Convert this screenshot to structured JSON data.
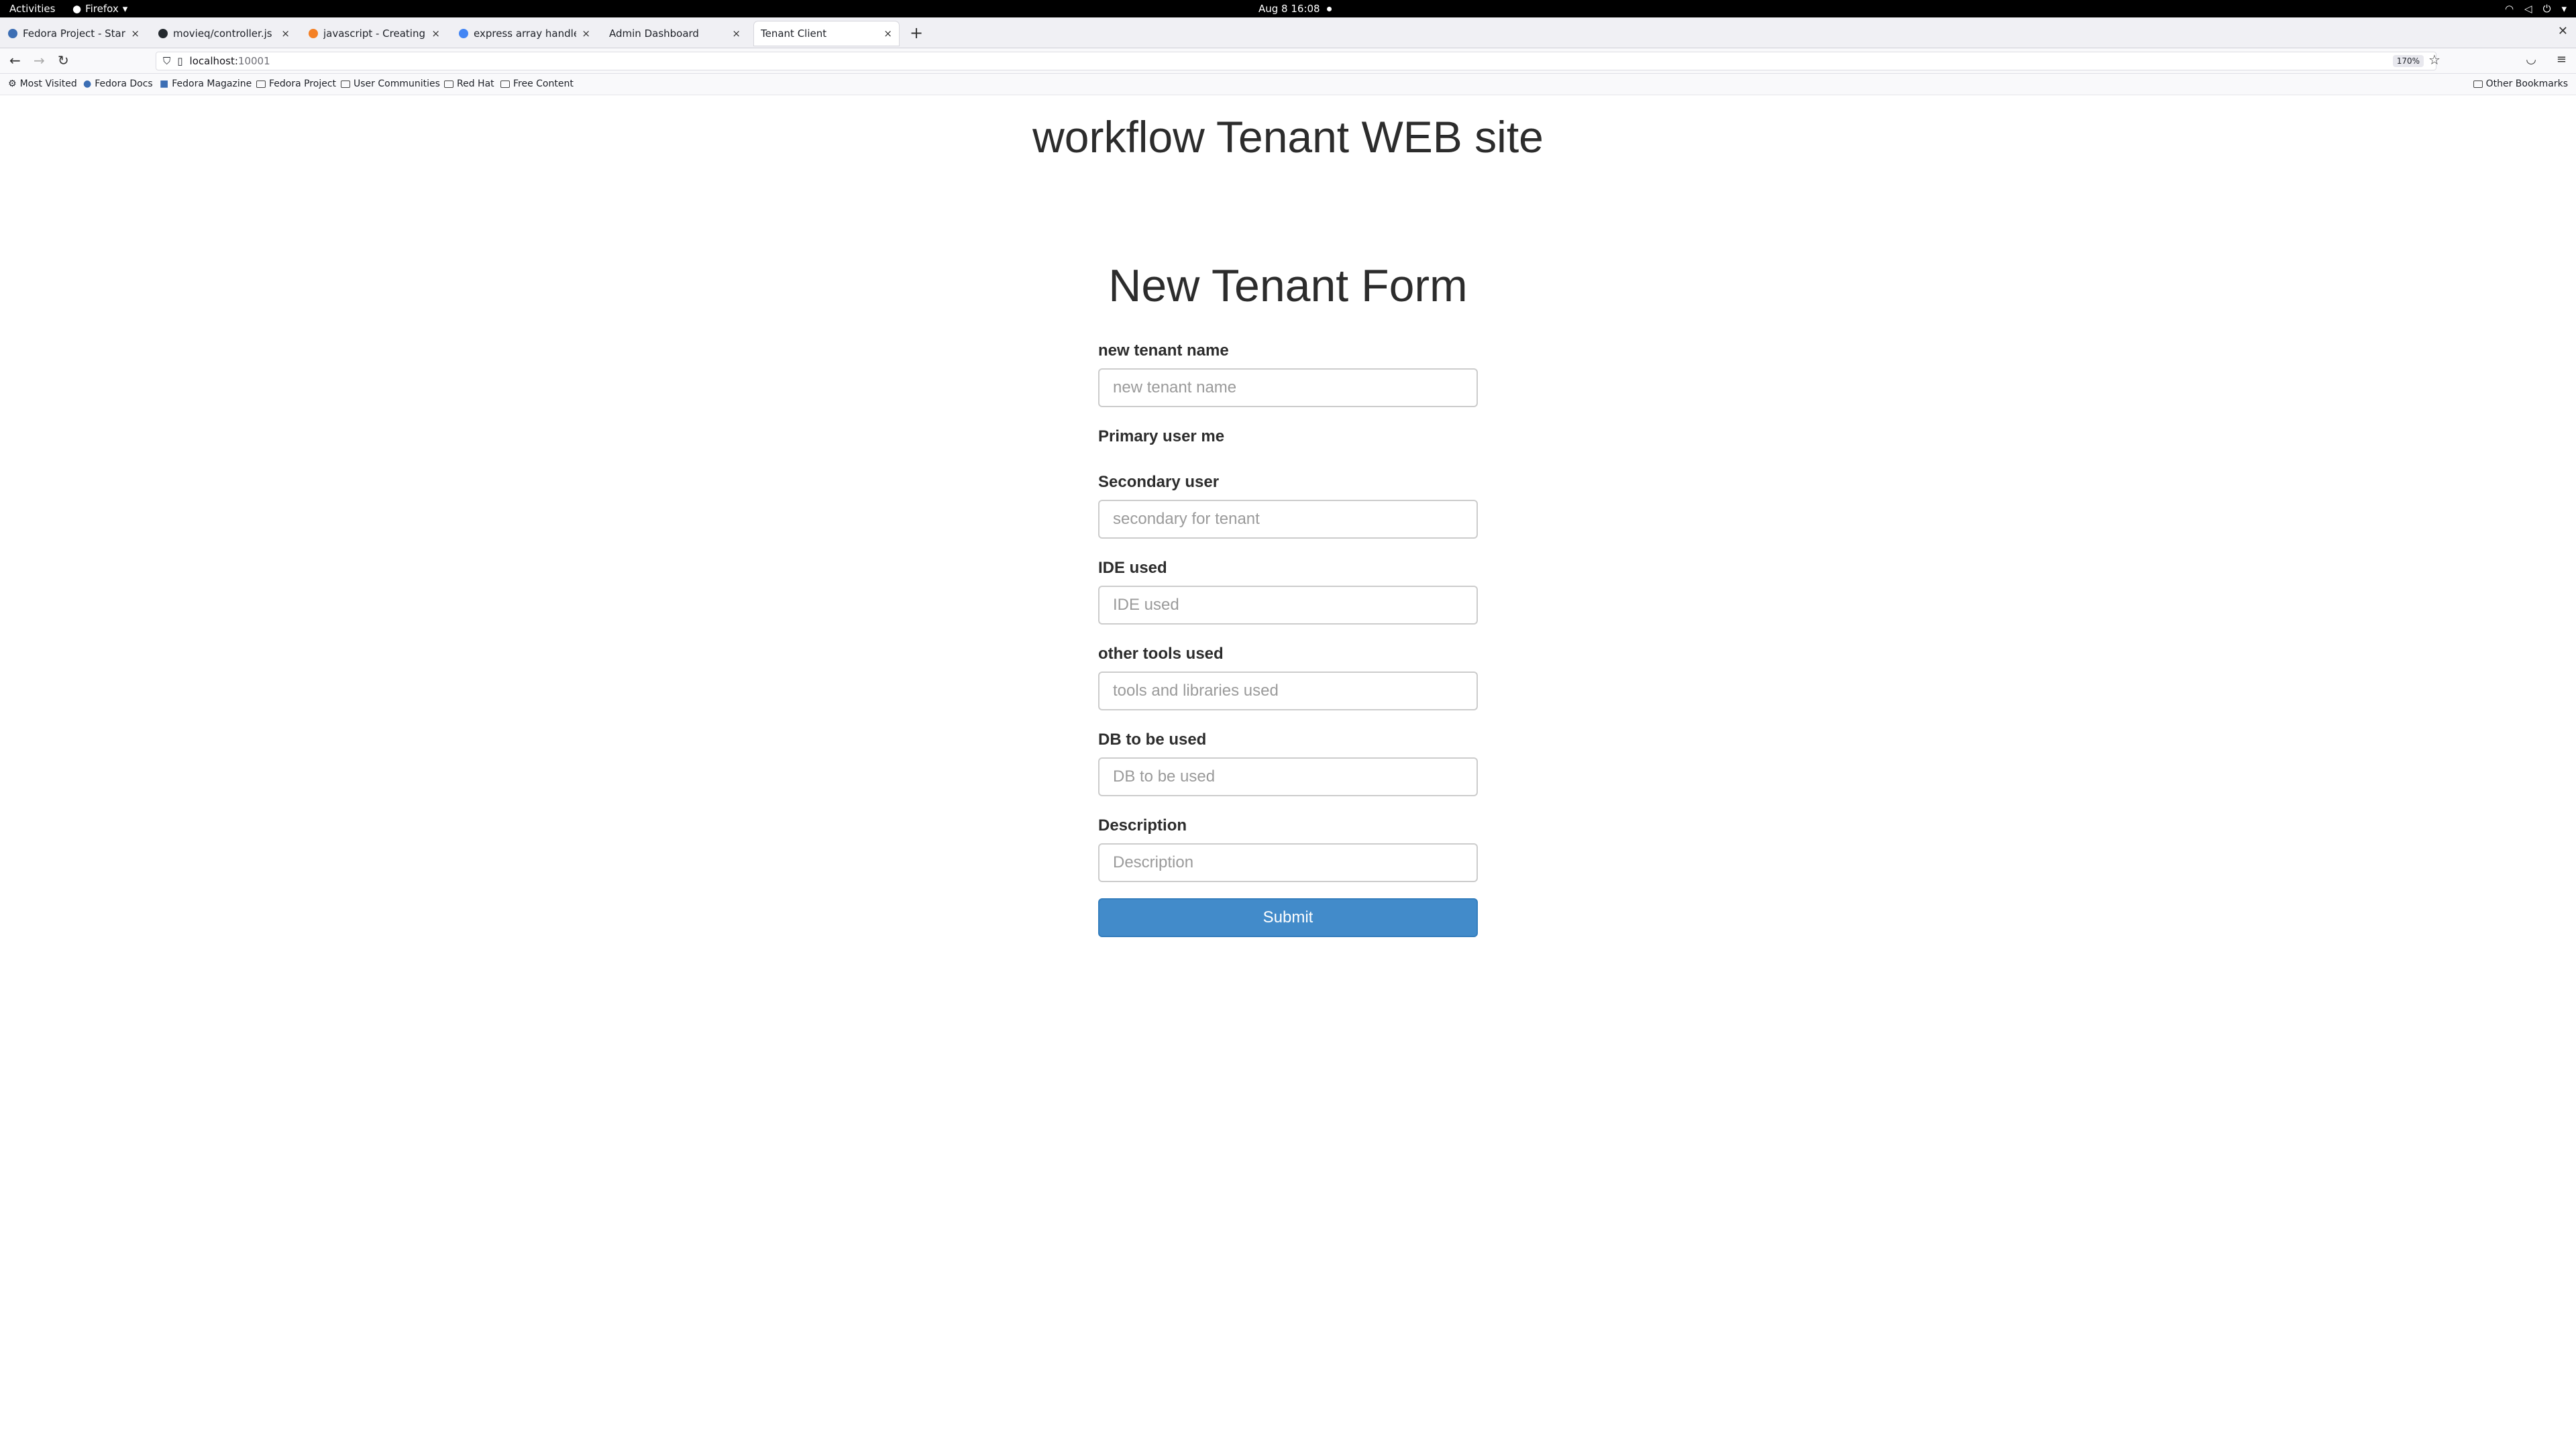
{
  "system": {
    "activities": "Activities",
    "app_name": "Firefox",
    "clock": "Aug 8  16:08"
  },
  "tabs": [
    {
      "title": "Fedora Project - Start Pa",
      "favicon_color": "#3c6eb4"
    },
    {
      "title": "movieq/controller.js at m",
      "favicon_color": "#24292e"
    },
    {
      "title": "javascript - Creating a JSC",
      "favicon_color": "#f48024"
    },
    {
      "title": "express array handlebars",
      "favicon_color": "#4285f4"
    },
    {
      "title": "Admin Dashboard",
      "favicon_color": ""
    },
    {
      "title": "Tenant Client",
      "favicon_color": "",
      "active": true
    }
  ],
  "navbar": {
    "url_host": "localhost:",
    "url_port": "10001",
    "zoom": "170%"
  },
  "bookmarks": {
    "items": [
      "Most Visited",
      "Fedora Docs",
      "Fedora Magazine",
      "Fedora Project",
      "User Communities",
      "Red Hat",
      "Free Content"
    ],
    "other": "Other Bookmarks"
  },
  "page": {
    "site_title": "workflow Tenant WEB site",
    "form_title": "New Tenant Form",
    "fields": {
      "tenant_name": {
        "label": "new tenant name",
        "placeholder": "new tenant name"
      },
      "primary_user": {
        "label": "Primary user me"
      },
      "secondary_user": {
        "label": "Secondary user",
        "placeholder": "secondary for tenant"
      },
      "ide": {
        "label": "IDE used",
        "placeholder": "IDE used"
      },
      "tools": {
        "label": "other tools used",
        "placeholder": "tools and libraries used"
      },
      "db": {
        "label": "DB to be used",
        "placeholder": "DB to be used"
      },
      "description": {
        "label": "Description",
        "placeholder": "Description"
      }
    },
    "submit_label": "Submit"
  }
}
